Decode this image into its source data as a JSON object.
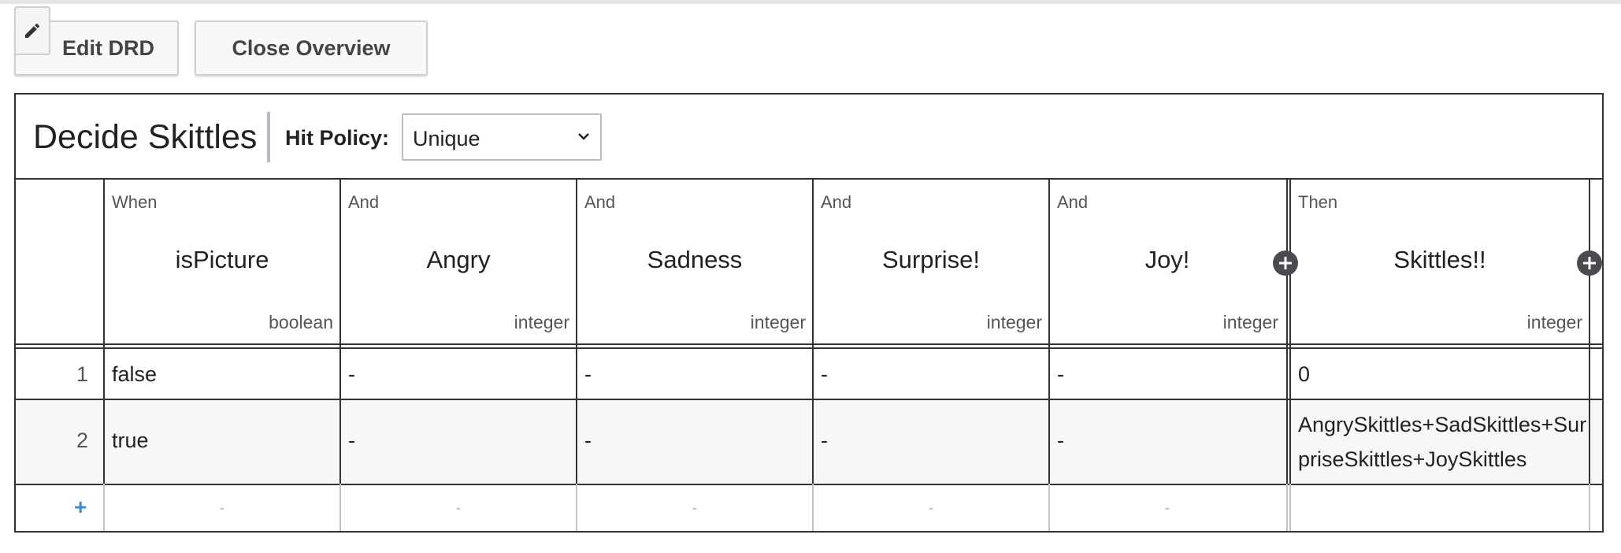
{
  "toolbar": {
    "edit_drd_label": "Edit DRD",
    "close_overview_label": "Close Overview"
  },
  "decision": {
    "name": "Decide Skittles",
    "hit_policy_label": "Hit Policy:",
    "hit_policy_value": "Unique"
  },
  "columns": [
    {
      "clause": "When",
      "name": "isPicture",
      "type": "boolean"
    },
    {
      "clause": "And",
      "name": "Angry",
      "type": "integer"
    },
    {
      "clause": "And",
      "name": "Sadness",
      "type": "integer"
    },
    {
      "clause": "And",
      "name": "Surprise!",
      "type": "integer"
    },
    {
      "clause": "And",
      "name": "Joy!",
      "type": "integer"
    },
    {
      "clause": "Then",
      "name": "Skittles!!",
      "type": "integer"
    }
  ],
  "rules": [
    {
      "num": "1",
      "cells": [
        "false",
        "-",
        "-",
        "-",
        "-",
        "0"
      ]
    },
    {
      "num": "2",
      "cells": [
        "true",
        "-",
        "-",
        "-",
        "-",
        "AngrySkittles+SadSkittles+SurpriseSkittles+JoySkittles"
      ]
    }
  ],
  "add_rule": {
    "label": "+",
    "placeholders": [
      "-",
      "-",
      "-",
      "-",
      "-"
    ]
  },
  "colors": {
    "border": "#333333",
    "add_button": "#4a4a4f",
    "add_rule": "#3a8fd8",
    "row_alt": "#f7f7f7"
  }
}
